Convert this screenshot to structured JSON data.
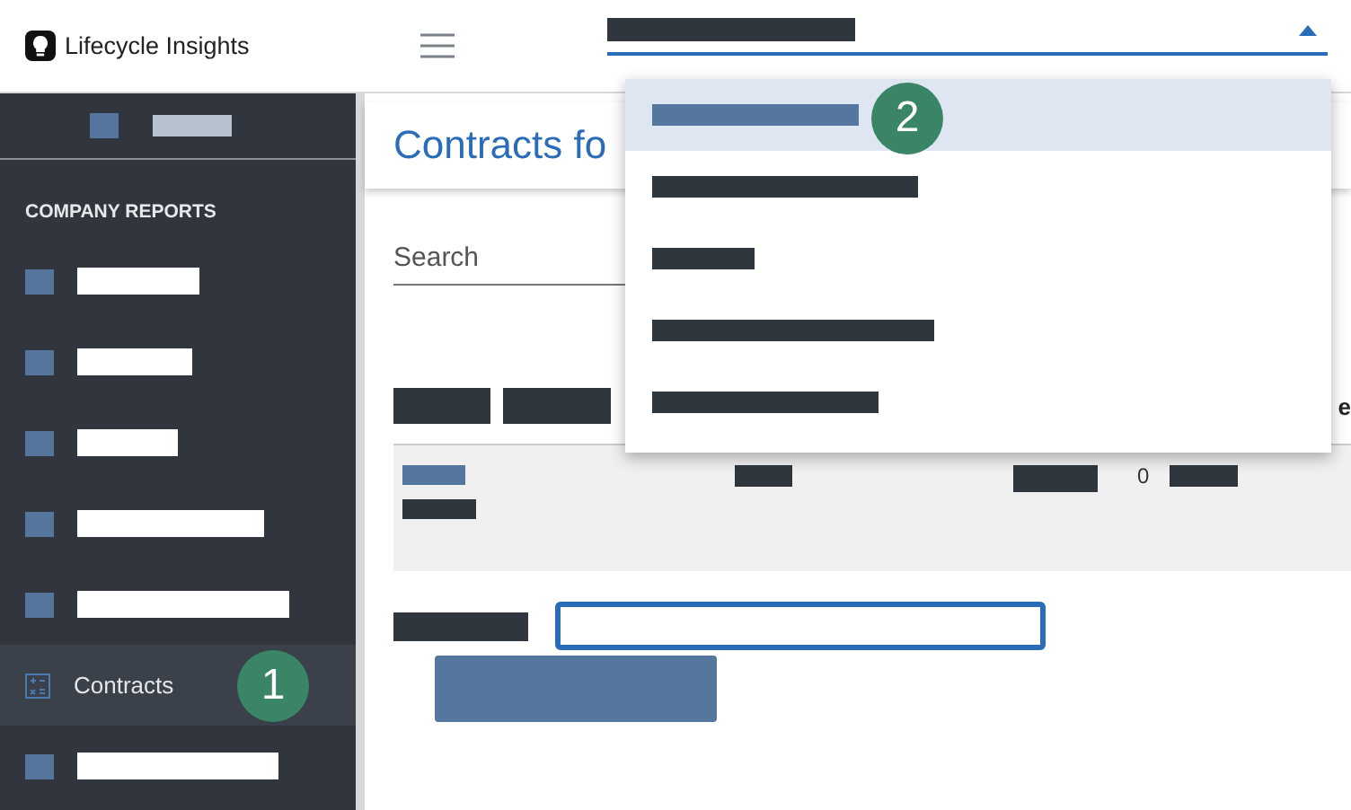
{
  "header": {
    "logo_text": "Lifecycle Insights"
  },
  "sidebar": {
    "section_title": "COMPANY REPORTS",
    "items": [
      {
        "kind": "redacted",
        "selected": false
      },
      {
        "kind": "redacted",
        "selected": false
      },
      {
        "kind": "redacted",
        "selected": false
      },
      {
        "kind": "redacted",
        "selected": false
      },
      {
        "kind": "redacted",
        "selected": false
      },
      {
        "kind": "report",
        "label": "Contracts",
        "selected": true,
        "badge": "1"
      },
      {
        "kind": "redacted",
        "selected": false
      }
    ]
  },
  "page": {
    "title": "Contracts fo",
    "search": {
      "placeholder": "Search"
    },
    "table": {
      "header_tail": "e",
      "row": {
        "count": "0"
      }
    }
  },
  "dropdown": {
    "expanded": true,
    "options": [
      {
        "selected": true,
        "badge": "2"
      },
      {
        "selected": false
      },
      {
        "selected": false
      },
      {
        "selected": false
      },
      {
        "selected": false
      }
    ]
  }
}
